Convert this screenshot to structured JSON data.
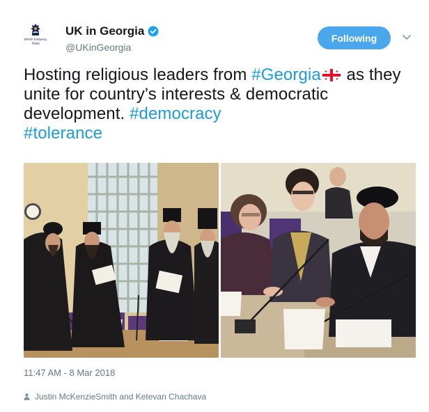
{
  "account": {
    "display_name": "UK in Georgia",
    "handle": "@UKinGeorgia",
    "avatar_lines": [
      "British Embassy",
      "Tbilisi"
    ],
    "verified": true
  },
  "actions": {
    "follow_label": "Following"
  },
  "tweet": {
    "text_parts": [
      {
        "text": "Hosting religious leaders from ",
        "hashtag": false
      },
      {
        "text": "#Georgia",
        "hashtag": true
      },
      {
        "text": " as they unite for country’s interests & democratic development. ",
        "hashtag": false
      },
      {
        "text": "#democracy",
        "hashtag": true
      },
      {
        "text": "#tolerance",
        "hashtag": true
      }
    ],
    "flag_icon": "georgia-flag-icon",
    "timestamp": "11:47 AM - 8 Mar 2018",
    "tagged_people": "Justin McKenzieSmith and Ketevan Chachava"
  },
  "colors": {
    "accent": "#1d9bd6",
    "follow_button": "#4ba7ec",
    "secondary_text": "#657786"
  }
}
